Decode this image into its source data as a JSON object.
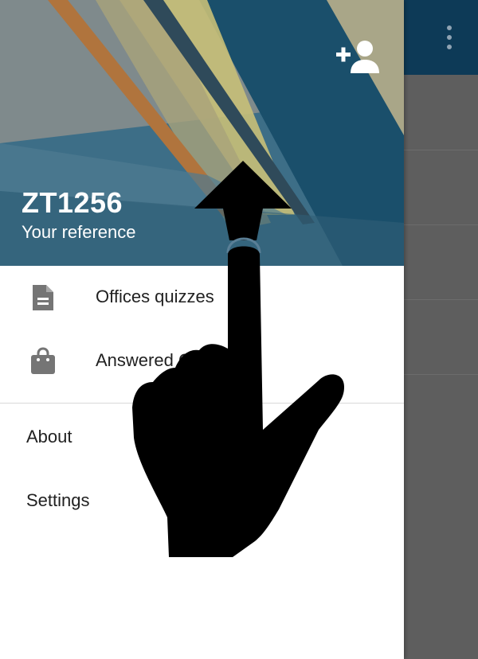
{
  "colors": {
    "toolbar": "#0d3a57",
    "scrim": "#5e5e5e",
    "header_base": "#2f5f78",
    "icon_gray": "#757575",
    "text": "#212121"
  },
  "toolbar": {
    "overflow_icon": "more-vert"
  },
  "drawer": {
    "header": {
      "add_account_icon": "person-add",
      "account_name": "ZT1256",
      "account_subtitle": "Your reference"
    },
    "primary_items": [
      {
        "label": "Offices quizzes",
        "icon": "document"
      },
      {
        "label": "Answered Quizzes",
        "icon": "shopping-bag"
      }
    ],
    "secondary_items": [
      {
        "label": "About"
      },
      {
        "label": "Settings"
      }
    ]
  },
  "overlay": {
    "icon": "swipe-up-hand-gesture"
  }
}
